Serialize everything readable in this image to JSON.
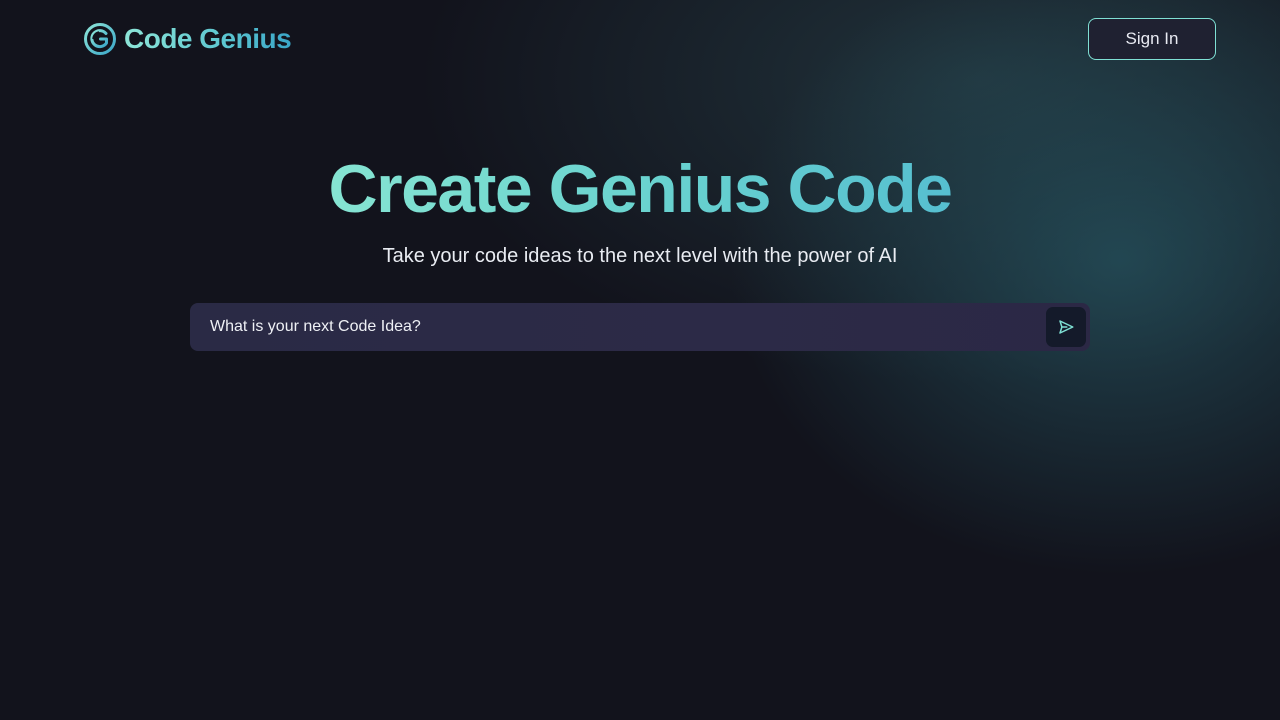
{
  "header": {
    "logo_icon": "code-genius-logo-icon",
    "logo_text": "Code Genius",
    "sign_in_label": "Sign In"
  },
  "hero": {
    "title": "Create Genius Code",
    "subtitle": "Take your code ideas to the next level with the power of AI"
  },
  "prompt": {
    "placeholder": "What is your next Code Idea?",
    "value": "",
    "send_icon": "send-icon"
  },
  "colors": {
    "background": "#12131c",
    "accent": "#7fe0d4",
    "input_bg": "#2a2a45",
    "button_bg": "#1f2131"
  }
}
